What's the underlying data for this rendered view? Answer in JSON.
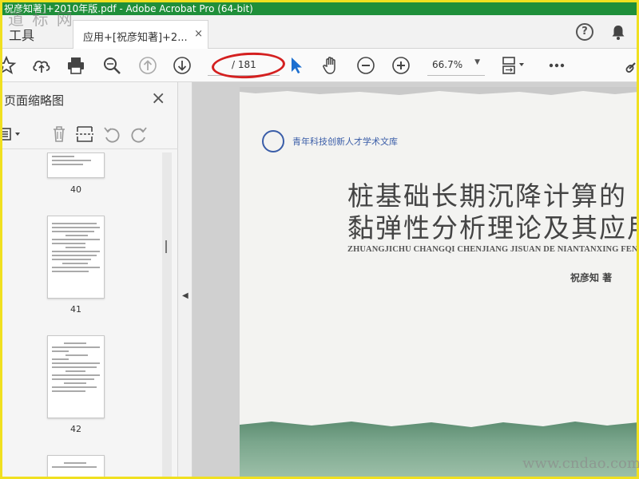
{
  "window": {
    "title": "祝彦知著]+2010年版.pdf - Adobe Acrobat Pro (64-bit)",
    "accent": "#1f8f3a"
  },
  "tabs": {
    "tools_label": "工具",
    "doc_label": "应用+[祝彦知著]+2...",
    "close_glyph": "×"
  },
  "toolbar": {
    "help_glyph": "?",
    "page_display": "/ 181",
    "zoom_value": "66.7%",
    "icons": [
      "bookmark-star-icon",
      "upload-cloud-icon",
      "print-icon",
      "zoom-search-icon",
      "previous-page-icon",
      "next-page-icon",
      "select-arrow-icon",
      "hand-icon",
      "zoom-out-icon",
      "zoom-in-icon",
      "page-display-icon",
      "more-icon",
      "link-icon"
    ]
  },
  "annotation": {
    "oval_color": "#d42020"
  },
  "panel": {
    "title": "页面缩略图",
    "close_glyph": "×",
    "thumbnails": [
      {
        "label": "40"
      },
      {
        "label": "41"
      },
      {
        "label": "42"
      }
    ]
  },
  "document": {
    "series": "青年科技创新人才学术文库",
    "title_line1": "桩基础长期沉降计算的",
    "title_line2": "黏弹性分析理论及其应用",
    "pinyin": "ZHUANGJICHU CHANGQI CHENJIANG JISUAN DE NIANTANXING FENXI LILUN JI QI YINGYONG",
    "author": "祝彦知 著"
  },
  "watermarks": {
    "top_left": "道 标 网",
    "bottom_right": "www.cndao.com"
  }
}
